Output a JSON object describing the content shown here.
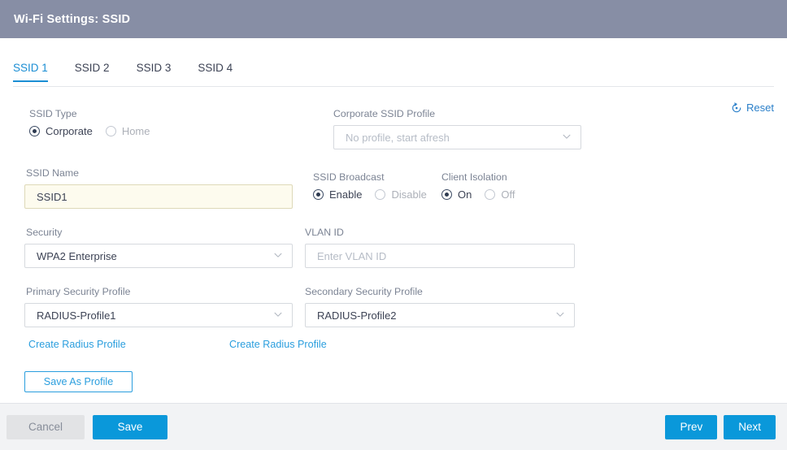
{
  "window": {
    "title": "Wi-Fi Settings: SSID"
  },
  "tabs": [
    {
      "label": "SSID 1",
      "active": true
    },
    {
      "label": "SSID 2",
      "active": false
    },
    {
      "label": "SSID 3",
      "active": false
    },
    {
      "label": "SSID 4",
      "active": false
    }
  ],
  "reset": {
    "label": "Reset",
    "icon": "reset-circular-arrow-icon",
    "color": "#2a7fc9"
  },
  "form": {
    "ssid_type": {
      "label": "SSID Type",
      "options": [
        {
          "label": "Corporate",
          "selected": true
        },
        {
          "label": "Home",
          "selected": false
        }
      ]
    },
    "corporate_ssid_profile": {
      "label": "Corporate SSID Profile",
      "value": "No profile, start afresh",
      "disabled": true,
      "caret": "chevron-down-icon"
    },
    "ssid_name": {
      "label": "SSID Name",
      "value": "SSID1",
      "autofilled": true
    },
    "ssid_broadcast": {
      "label": "SSID Broadcast",
      "options": [
        {
          "label": "Enable",
          "selected": true
        },
        {
          "label": "Disable",
          "selected": false
        }
      ]
    },
    "client_isolation": {
      "label": "Client Isolation",
      "options": [
        {
          "label": "On",
          "selected": true
        },
        {
          "label": "Off",
          "selected": false
        }
      ]
    },
    "security": {
      "label": "Security",
      "value": "WPA2 Enterprise",
      "caret": "chevron-down-icon"
    },
    "vlan_id": {
      "label": "VLAN ID",
      "value": "",
      "placeholder": "Enter VLAN ID"
    },
    "primary_security_profile": {
      "label": "Primary Security Profile",
      "value": "RADIUS-Profile1",
      "caret": "chevron-down-icon",
      "create_link": "Create Radius Profile"
    },
    "secondary_security_profile": {
      "label": "Secondary Security Profile",
      "value": "RADIUS-Profile2",
      "caret": "chevron-down-icon",
      "create_link": "Create Radius Profile"
    },
    "save_as_profile": {
      "label": "Save As Profile"
    }
  },
  "footer": {
    "cancel": "Cancel",
    "save": "Save",
    "prev": "Prev",
    "next": "Next"
  },
  "colors": {
    "header_bar": "#878ea5",
    "accent_blue": "#0a98da",
    "link_blue": "#2a9ede",
    "tab_active": "#1b8ed4",
    "footer_bg": "#f2f3f5",
    "autofill_bg": "#fdfbee"
  }
}
